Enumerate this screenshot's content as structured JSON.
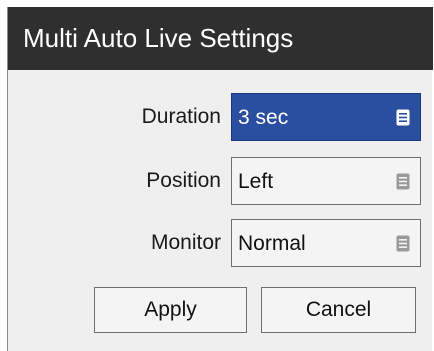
{
  "dialog": {
    "title": "Multi Auto Live Settings"
  },
  "settings": {
    "duration": {
      "label": "Duration",
      "value": "3 sec"
    },
    "position": {
      "label": "Position",
      "value": "Left"
    },
    "monitor": {
      "label": "Monitor",
      "value": "Normal"
    }
  },
  "buttons": {
    "apply": "Apply",
    "cancel": "Cancel"
  },
  "icons": {
    "dropdown": "list-icon"
  },
  "colors": {
    "titlebar": "#2f2f2f",
    "selected_field": "#2a4fa0",
    "panel": "#efefef"
  }
}
